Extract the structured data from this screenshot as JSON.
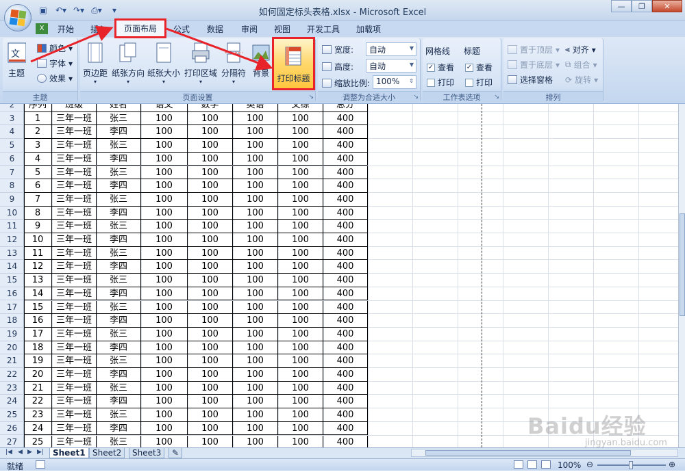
{
  "window": {
    "title": "如何固定标头表格.xlsx - Microsoft Excel"
  },
  "tabs": [
    "开始",
    "插入",
    "页面布局",
    "公式",
    "数据",
    "审阅",
    "视图",
    "开发工具",
    "加载项"
  ],
  "active_tab": "页面布局",
  "ribbon": {
    "themes": {
      "label": "主题",
      "main_btn": "主题",
      "colors": "颜色",
      "fonts": "字体",
      "effects": "效果"
    },
    "page_setup": {
      "label": "页面设置",
      "buttons": [
        "页边距",
        "纸张方向",
        "纸张大小",
        "打印区域",
        "分隔符",
        "背景",
        "打印标题"
      ]
    },
    "scale": {
      "label": "调整为合适大小",
      "width_label": "宽度:",
      "width_value": "自动",
      "height_label": "高度:",
      "height_value": "自动",
      "scale_label": "缩放比例:",
      "scale_value": "100%"
    },
    "sheet_options": {
      "label": "工作表选项",
      "gridlines": "网格线",
      "headings": "标题",
      "view": "查看",
      "print": "打印"
    },
    "arrange": {
      "label": "排列",
      "bring_front": "置于顶层",
      "send_back": "置于底层",
      "selection_pane": "选择窗格",
      "align": "对齐",
      "group": "组合",
      "rotate": "旋转"
    }
  },
  "sheet": {
    "partial_header": [
      "序列",
      "班级",
      "姓名",
      "语文",
      "数学",
      "英语",
      "文综",
      "总分"
    ],
    "header_row_num": "2",
    "rows": [
      [
        "3",
        "1",
        "三年一班",
        "张三",
        "100",
        "100",
        "100",
        "100",
        "400"
      ],
      [
        "4",
        "2",
        "三年一班",
        "李四",
        "100",
        "100",
        "100",
        "100",
        "400"
      ],
      [
        "5",
        "3",
        "三年一班",
        "张三",
        "100",
        "100",
        "100",
        "100",
        "400"
      ],
      [
        "6",
        "4",
        "三年一班",
        "李四",
        "100",
        "100",
        "100",
        "100",
        "400"
      ],
      [
        "7",
        "5",
        "三年一班",
        "张三",
        "100",
        "100",
        "100",
        "100",
        "400"
      ],
      [
        "8",
        "6",
        "三年一班",
        "李四",
        "100",
        "100",
        "100",
        "100",
        "400"
      ],
      [
        "9",
        "7",
        "三年一班",
        "张三",
        "100",
        "100",
        "100",
        "100",
        "400"
      ],
      [
        "10",
        "8",
        "三年一班",
        "李四",
        "100",
        "100",
        "100",
        "100",
        "400"
      ],
      [
        "11",
        "9",
        "三年一班",
        "张三",
        "100",
        "100",
        "100",
        "100",
        "400"
      ],
      [
        "12",
        "10",
        "三年一班",
        "李四",
        "100",
        "100",
        "100",
        "100",
        "400"
      ],
      [
        "13",
        "11",
        "三年一班",
        "张三",
        "100",
        "100",
        "100",
        "100",
        "400"
      ],
      [
        "14",
        "12",
        "三年一班",
        "李四",
        "100",
        "100",
        "100",
        "100",
        "400"
      ],
      [
        "15",
        "13",
        "三年一班",
        "张三",
        "100",
        "100",
        "100",
        "100",
        "400"
      ],
      [
        "16",
        "14",
        "三年一班",
        "李四",
        "100",
        "100",
        "100",
        "100",
        "400"
      ],
      [
        "17",
        "15",
        "三年一班",
        "张三",
        "100",
        "100",
        "100",
        "100",
        "400"
      ],
      [
        "18",
        "16",
        "三年一班",
        "李四",
        "100",
        "100",
        "100",
        "100",
        "400"
      ],
      [
        "19",
        "17",
        "三年一班",
        "张三",
        "100",
        "100",
        "100",
        "100",
        "400"
      ],
      [
        "20",
        "18",
        "三年一班",
        "李四",
        "100",
        "100",
        "100",
        "100",
        "400"
      ],
      [
        "21",
        "19",
        "三年一班",
        "张三",
        "100",
        "100",
        "100",
        "100",
        "400"
      ],
      [
        "22",
        "20",
        "三年一班",
        "李四",
        "100",
        "100",
        "100",
        "100",
        "400"
      ],
      [
        "23",
        "21",
        "三年一班",
        "张三",
        "100",
        "100",
        "100",
        "100",
        "400"
      ],
      [
        "24",
        "22",
        "三年一班",
        "李四",
        "100",
        "100",
        "100",
        "100",
        "400"
      ],
      [
        "25",
        "23",
        "三年一班",
        "张三",
        "100",
        "100",
        "100",
        "100",
        "400"
      ],
      [
        "26",
        "24",
        "三年一班",
        "李四",
        "100",
        "100",
        "100",
        "100",
        "400"
      ],
      [
        "27",
        "25",
        "三年一班",
        "张三",
        "100",
        "100",
        "100",
        "100",
        "400"
      ]
    ]
  },
  "sheet_tabs": [
    "Sheet1",
    "Sheet2",
    "Sheet3"
  ],
  "status": {
    "ready": "就绪",
    "zoom": "100%"
  },
  "watermark": {
    "brand": "Baidu经验",
    "url": "jingyan.baidu.com"
  },
  "colors": {
    "highlight": "#e8242a",
    "ribbon_bg": "#c4d7ef",
    "active_button": "#ffc63e"
  }
}
